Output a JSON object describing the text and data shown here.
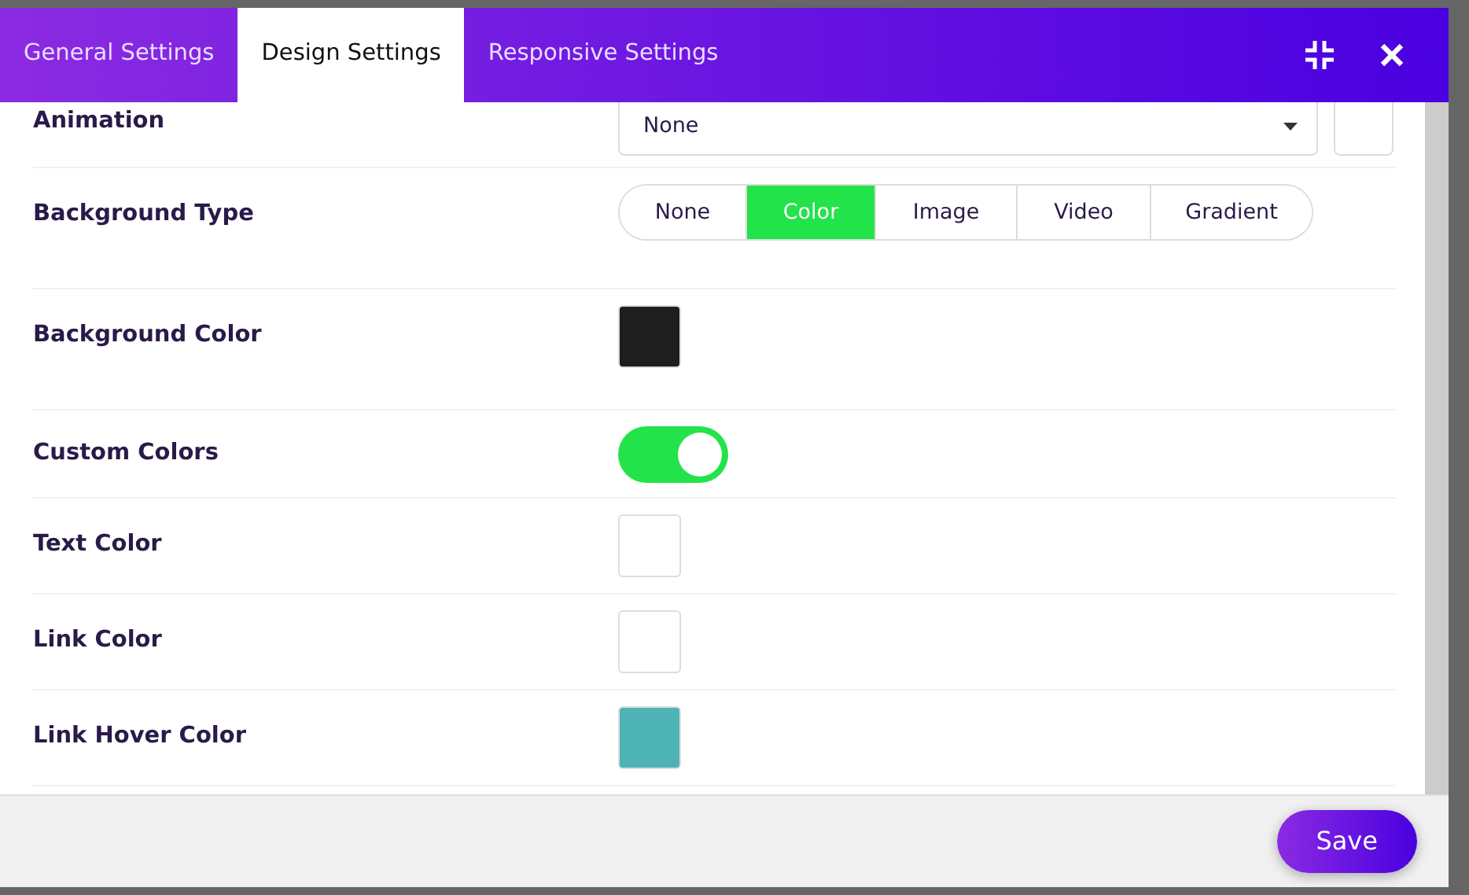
{
  "tabs": [
    {
      "label": "General Settings",
      "selected": false
    },
    {
      "label": "Design Settings",
      "selected": true
    },
    {
      "label": "Responsive Settings",
      "selected": false
    }
  ],
  "settings": [
    {
      "kind": "select",
      "label": "Animation",
      "value": "None"
    },
    {
      "kind": "segmented",
      "label": "Background Type",
      "options": [
        {
          "label": "None",
          "selected": false
        },
        {
          "label": "Color",
          "selected": true
        },
        {
          "label": "Image",
          "selected": false
        },
        {
          "label": "Video",
          "selected": false
        },
        {
          "label": "Gradient",
          "selected": false
        }
      ]
    },
    {
      "kind": "color",
      "label": "Background Color",
      "color": "#1e1e1e"
    },
    {
      "kind": "toggle",
      "label": "Custom Colors",
      "on": true
    },
    {
      "kind": "color",
      "label": "Text Color",
      "color": "#ffffff"
    },
    {
      "kind": "color",
      "label": "Link Color",
      "color": "#ffffff"
    },
    {
      "kind": "color",
      "label": "Link Hover Color",
      "color": "#4db3b5"
    }
  ],
  "footer": {
    "save_button": "Save"
  }
}
